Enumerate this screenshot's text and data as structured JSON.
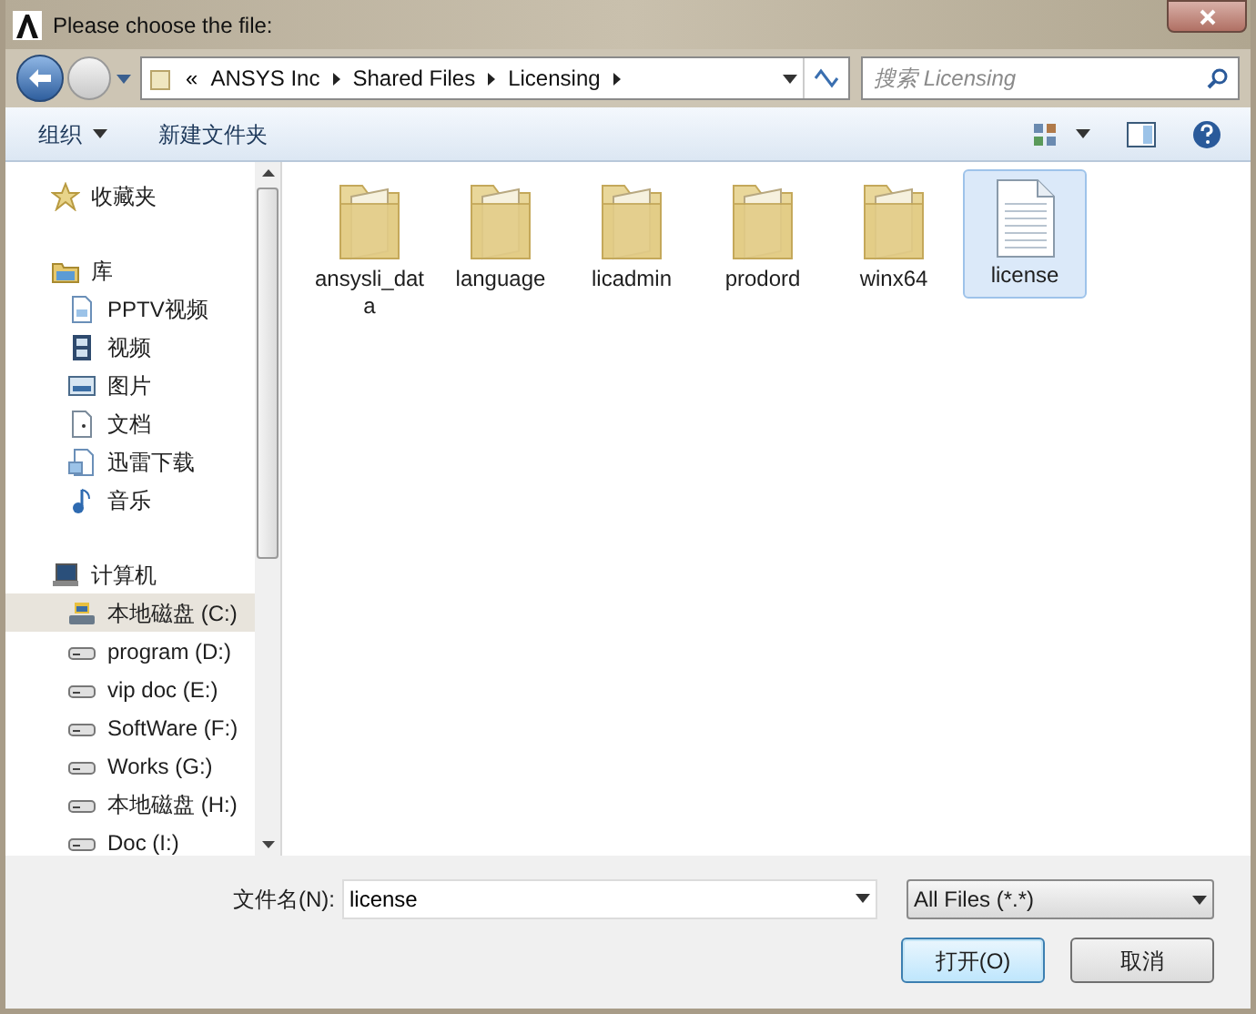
{
  "window": {
    "title": "Please choose the file:"
  },
  "breadcrumb": {
    "overflow": "«",
    "segments": [
      "ANSYS Inc",
      "Shared Files",
      "Licensing"
    ]
  },
  "search": {
    "placeholder": "搜索 Licensing"
  },
  "toolbar": {
    "organize": "组织",
    "new_folder": "新建文件夹"
  },
  "sidebar": [
    {
      "label": "收藏夹",
      "kind": "favorites",
      "selected": false
    },
    {
      "label": "库",
      "kind": "library",
      "selected": false,
      "items": [
        {
          "label": "PPTV视频",
          "kind": "media",
          "selected": false
        },
        {
          "label": "视频",
          "kind": "video",
          "selected": false
        },
        {
          "label": "图片",
          "kind": "picture",
          "selected": false
        },
        {
          "label": "文档",
          "kind": "document",
          "selected": false
        },
        {
          "label": "迅雷下载",
          "kind": "download",
          "selected": false
        },
        {
          "label": "音乐",
          "kind": "music",
          "selected": false
        }
      ]
    },
    {
      "label": "计算机",
      "kind": "computer",
      "selected": false,
      "items": [
        {
          "label": "本地磁盘 (C:)",
          "kind": "system-drive",
          "selected": true
        },
        {
          "label": "program (D:)",
          "kind": "drive",
          "selected": false
        },
        {
          "label": "vip doc (E:)",
          "kind": "drive",
          "selected": false
        },
        {
          "label": "SoftWare (F:)",
          "kind": "drive",
          "selected": false
        },
        {
          "label": "Works (G:)",
          "kind": "drive",
          "selected": false
        },
        {
          "label": "本地磁盘 (H:)",
          "kind": "drive",
          "selected": false
        },
        {
          "label": "Doc (I:)",
          "kind": "drive",
          "selected": false
        }
      ]
    }
  ],
  "files": [
    {
      "name": "ansysli_data",
      "kind": "folder",
      "selected": false
    },
    {
      "name": "language",
      "kind": "folder",
      "selected": false
    },
    {
      "name": "licadmin",
      "kind": "folder",
      "selected": false
    },
    {
      "name": "prodord",
      "kind": "folder",
      "selected": false
    },
    {
      "name": "winx64",
      "kind": "folder",
      "selected": false
    },
    {
      "name": "license",
      "kind": "file",
      "selected": true
    }
  ],
  "footer": {
    "filename_label": "文件名(N):",
    "filename": "license",
    "filetype": "All Files (*.*)",
    "buttons": [
      {
        "label": "打开(O)",
        "default": true
      },
      {
        "label": "取消",
        "default": false
      }
    ]
  }
}
